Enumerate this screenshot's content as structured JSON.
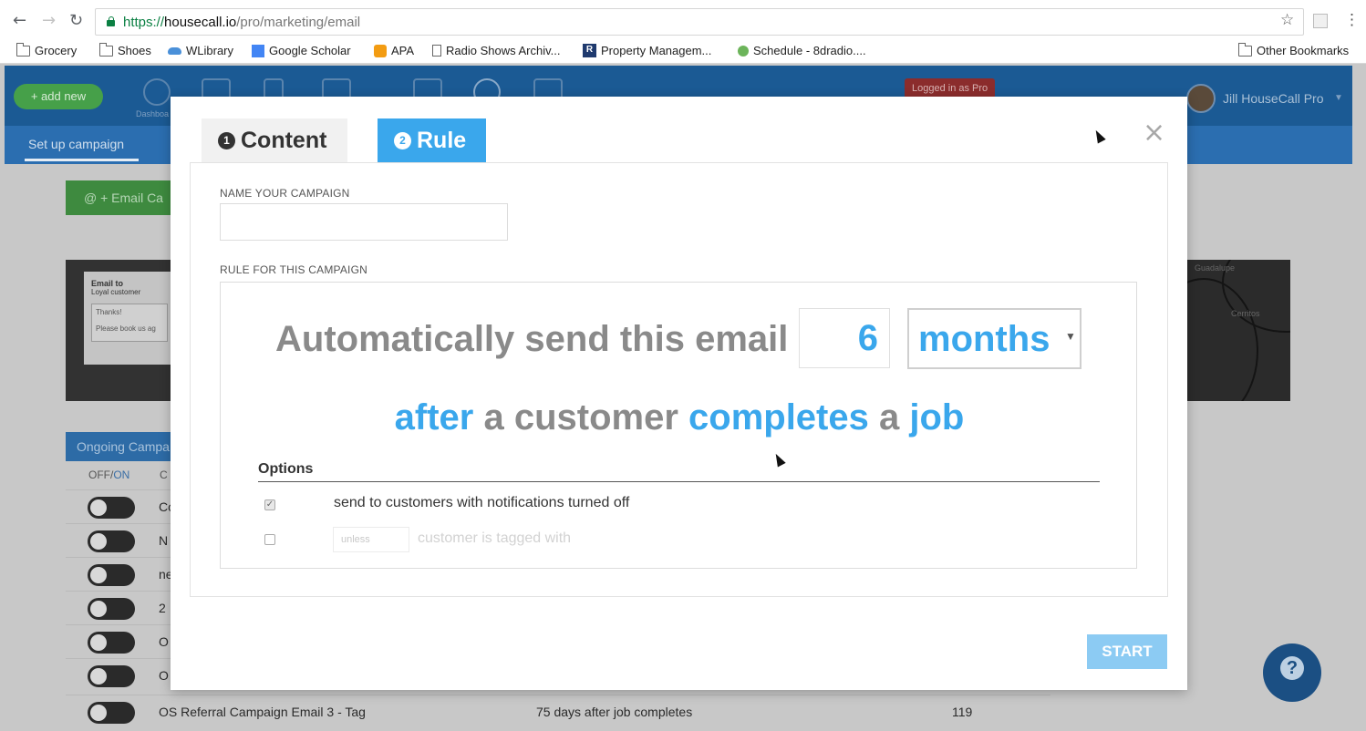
{
  "browser": {
    "url_protocol": "https://",
    "url_host": "housecall.io",
    "url_path": "/pro/marketing/email",
    "bookmarks": [
      "Grocery",
      "Shoes",
      "WLibrary",
      "Google Scholar",
      "APA",
      "Radio Shows Archiv...",
      "Property Managem...",
      "Schedule - 8dradio...."
    ],
    "other_bookmarks": "Other Bookmarks"
  },
  "app": {
    "add_new": "+ add new",
    "dashboard_label": "Dashboa",
    "logged_in": "Logged in as Pro",
    "user_name": "Jill HouseCall Pro",
    "subnav_tab": "Set up campaign",
    "email_cta": "@  + Email Ca",
    "preview": {
      "title": "Email to",
      "subtitle": "Loyal customer",
      "greeting": "Thanks!",
      "body": "Please book us ag"
    },
    "map_labels": [
      "Guadalupe",
      "Cerritos"
    ],
    "campaigns": {
      "header": "Ongoing Campa",
      "col_offon_off": "OFF/",
      "col_offon_on": "ON",
      "col_c": "C",
      "rows": [
        {
          "name": "Co",
          "rule": "",
          "count": ""
        },
        {
          "name": "N",
          "rule": "",
          "count": ""
        },
        {
          "name": "ne",
          "rule": "",
          "count": ""
        },
        {
          "name": "2",
          "rule": "",
          "count": ""
        },
        {
          "name": "O",
          "rule": "",
          "count": ""
        },
        {
          "name": "O",
          "rule": "",
          "count": ""
        },
        {
          "name": "OS Referral Campaign Email 3 - Tag",
          "rule": "75 days after job completes",
          "count": "119"
        }
      ]
    },
    "help": "?"
  },
  "modal": {
    "tabs": [
      {
        "num": "1",
        "label": "Content"
      },
      {
        "num": "2",
        "label": "Rule"
      }
    ],
    "close": "×",
    "name_label": "NAME YOUR CAMPAIGN",
    "name_value": "",
    "rule_label": "RULE FOR THIS CAMPAIGN",
    "rule": {
      "prefix": "Automatically send this email",
      "amount": "6",
      "unit": "months",
      "after": "after",
      "a_customer": " a customer ",
      "event": "completes",
      "a": " a ",
      "object": "job"
    },
    "options_title": "Options",
    "options": [
      {
        "checked": true,
        "label": "send to customers with notifications turned off"
      },
      {
        "checked": false,
        "unless": "unless",
        "label": "customer is tagged with"
      }
    ],
    "start": "START"
  },
  "colors": {
    "accent": "#3aa7ec",
    "nav": "#1b5a94",
    "start": "#8ccbf3",
    "cta_green": "#3e8a3f"
  }
}
